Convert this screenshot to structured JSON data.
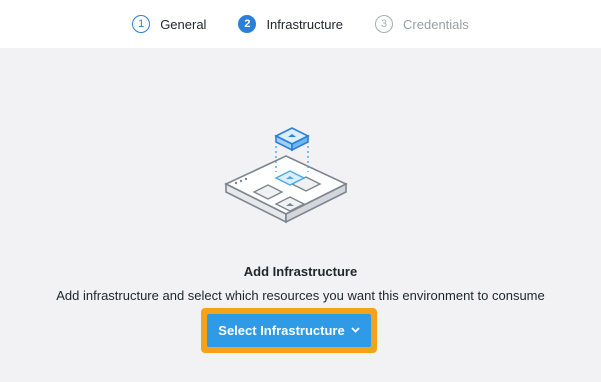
{
  "stepper": {
    "steps": [
      {
        "number": "1",
        "label": "General",
        "state": "done"
      },
      {
        "number": "2",
        "label": "Infrastructure",
        "state": "active"
      },
      {
        "number": "3",
        "label": "Credentials",
        "state": "pending"
      }
    ]
  },
  "empty_state": {
    "title": "Add Infrastructure",
    "description": "Add infrastructure and select which resources you want this environment to consume",
    "button_label": "Select Infrastructure",
    "button_icon": "chevron-down-icon"
  },
  "colors": {
    "accent": "#2b7fd9",
    "button": "#2f9be6",
    "highlight": "#f5a21b",
    "background": "#f2f2f4"
  }
}
